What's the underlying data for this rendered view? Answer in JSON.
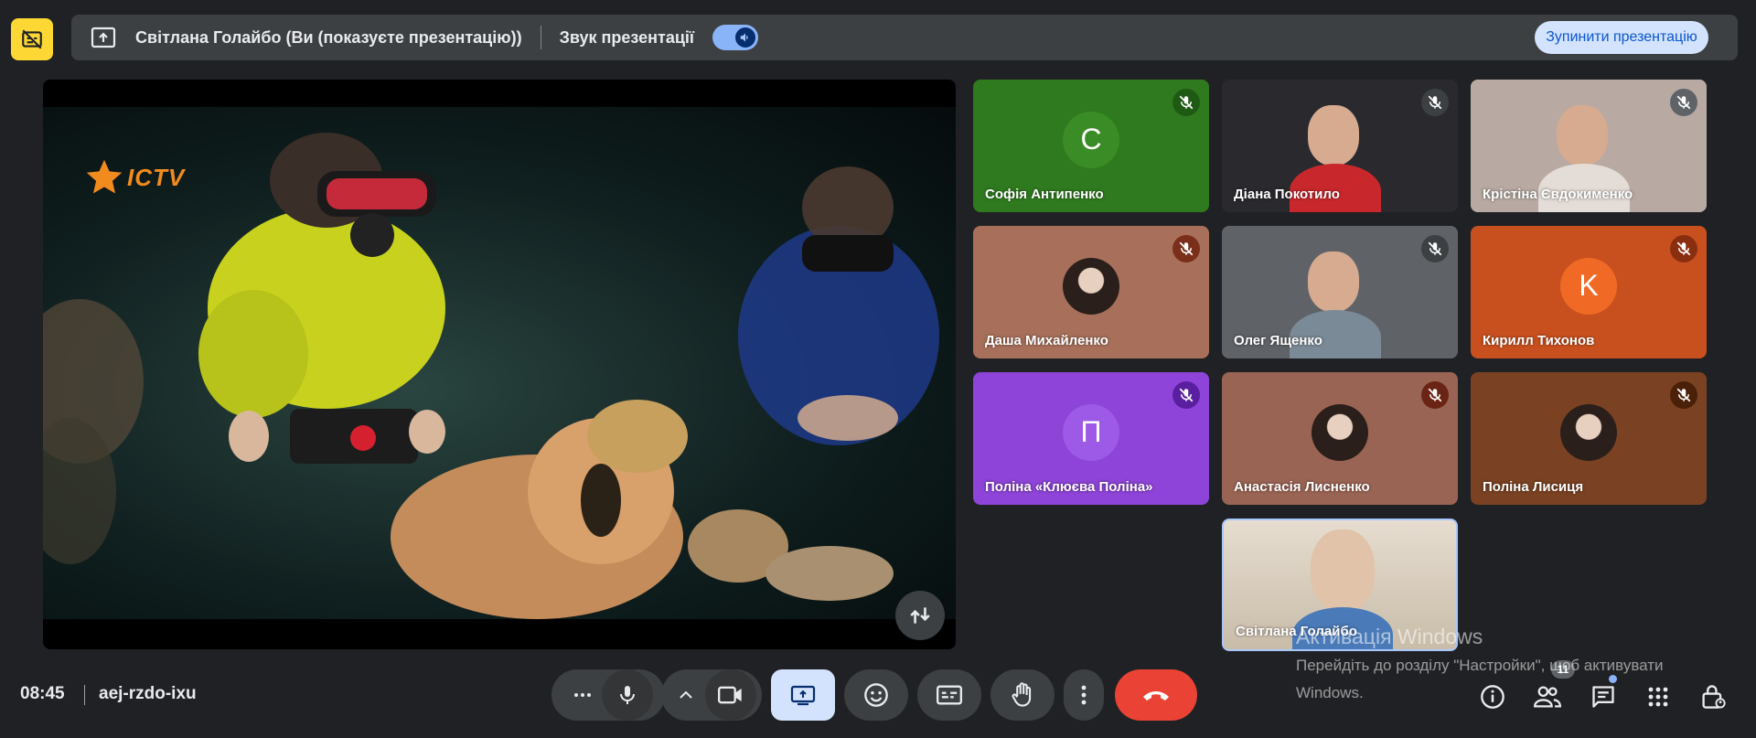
{
  "presenting_bar": {
    "title": "Світлана Голайбо (Ви (показуєте презентацію))",
    "audio_label": "Звук презентації",
    "audio_on": true,
    "stop_label": "Зупинити презентацію"
  },
  "main_video": {
    "logo": "ICTV"
  },
  "participants": [
    {
      "name": "Софія Антипенко",
      "initial": "C",
      "bg": "#2f7a1f",
      "avatar_bg": "#3a8c26",
      "mute_bg": "#1e5a14"
    },
    {
      "name": "Діана Покотило",
      "bg": "#2a2a2e",
      "mute_bg": "#3c4043"
    },
    {
      "name": "Крістіна Євдокименко",
      "bg": "#b8aaa2",
      "mute_bg": "#5f6368"
    },
    {
      "name": "Даша Михайленко",
      "bg": "#a8705a",
      "mute_bg": "#7a2f1a"
    },
    {
      "name": "Олег Ященко",
      "bg": "#5f6368",
      "mute_bg": "#3c4043"
    },
    {
      "name": "Кирилл Тихонов",
      "initial": "K",
      "bg": "#c8501e",
      "avatar_bg": "#f06a26",
      "mute_bg": "#8a2e10"
    },
    {
      "name": "Поліна «Клюєва Поліна»",
      "initial": "П",
      "bg": "#8e44d8",
      "avatar_bg": "#9c5ae6",
      "mute_bg": "#5a1fa0"
    },
    {
      "name": "Анастасія Лисненко",
      "bg": "#9a6454",
      "mute_bg": "#6a2414"
    },
    {
      "name": "Поліна Лисиця",
      "bg": "#7a4222",
      "mute_bg": "#4a2008"
    },
    {
      "name": "Світлана Голайбо",
      "bg": "#d8cfc2",
      "self": true
    }
  ],
  "bottom": {
    "time": "08:45",
    "meeting_code": "aej-rzdo-ixu",
    "people_count": "11"
  },
  "watermark": {
    "title": "Активація Windows",
    "line1": "Перейдіть до розділу \"Настройки\", щоб активувати",
    "line2": "Windows."
  }
}
